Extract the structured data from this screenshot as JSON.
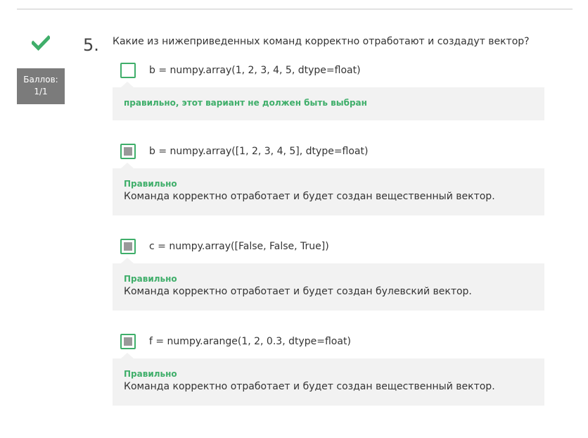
{
  "question": {
    "number": "5.",
    "text": "Какие из нижеприведенных команд корректно отработают и создадут вектор?",
    "status_icon": "check-icon",
    "score_label": "Баллов:",
    "score_value": "1/1"
  },
  "options": [
    {
      "label": "b = numpy.array(1, 2, 3, 4, 5, dtype=float)",
      "checked": false,
      "feedback_title": "правильно, этот вариант не должен быть выбран",
      "feedback_text": ""
    },
    {
      "label": "b = numpy.array([1, 2, 3, 4, 5], dtype=float)",
      "checked": true,
      "feedback_title": "Правильно",
      "feedback_text": "Команда корректно отработает и будет создан вещественный вектор."
    },
    {
      "label": "c = numpy.array([False, False, True])",
      "checked": true,
      "feedback_title": "Правильно",
      "feedback_text": "Команда корректно отработает и будет создан булевский вектор."
    },
    {
      "label": "f = numpy.arange(1, 2, 0.3, dtype=float)",
      "checked": true,
      "feedback_title": "Правильно",
      "feedback_text": "Команда корректно отработает и будет создан вещественный вектор."
    }
  ],
  "colors": {
    "accent_green": "#3fae6a",
    "score_bg": "#7b7b7b",
    "feedback_bg": "#f2f2f2"
  }
}
